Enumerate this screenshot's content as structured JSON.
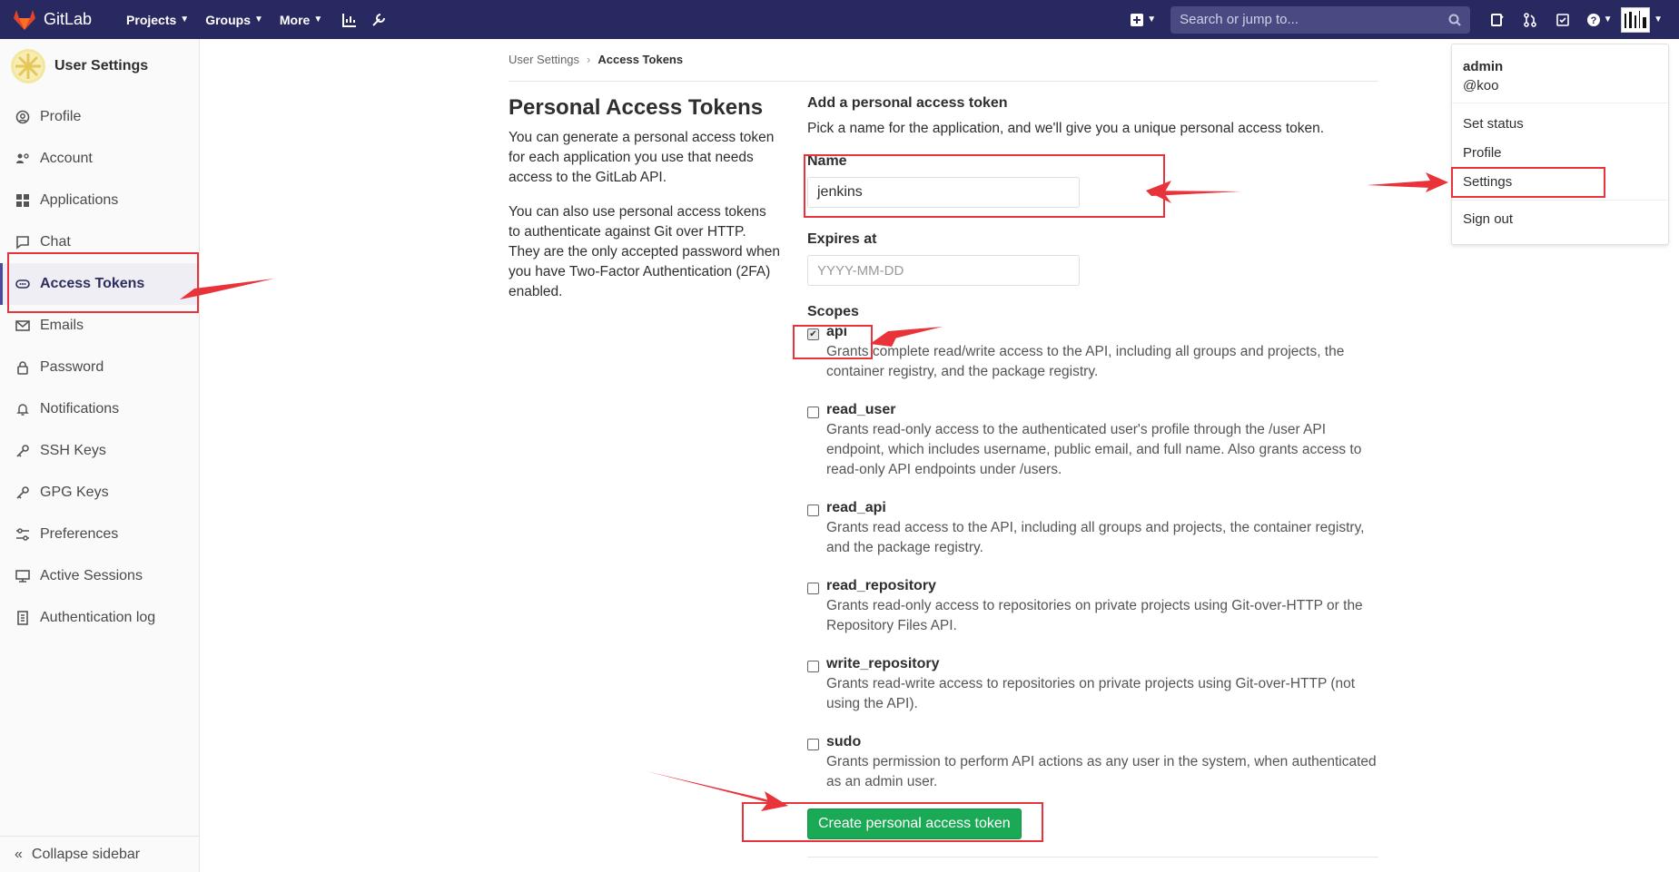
{
  "navbar": {
    "brand": "GitLab",
    "links": [
      {
        "label": "Projects"
      },
      {
        "label": "Groups"
      },
      {
        "label": "More"
      }
    ],
    "search_placeholder": "Search or jump to..."
  },
  "sidebar": {
    "title": "User Settings",
    "items": [
      {
        "label": "Profile",
        "icon": "profile-icon"
      },
      {
        "label": "Account",
        "icon": "account-icon"
      },
      {
        "label": "Applications",
        "icon": "applications-icon"
      },
      {
        "label": "Chat",
        "icon": "chat-icon"
      },
      {
        "label": "Access Tokens",
        "icon": "token-icon",
        "active": true
      },
      {
        "label": "Emails",
        "icon": "email-icon"
      },
      {
        "label": "Password",
        "icon": "lock-icon"
      },
      {
        "label": "Notifications",
        "icon": "bell-icon"
      },
      {
        "label": "SSH Keys",
        "icon": "key-icon"
      },
      {
        "label": "GPG Keys",
        "icon": "key-icon"
      },
      {
        "label": "Preferences",
        "icon": "preferences-icon"
      },
      {
        "label": "Active Sessions",
        "icon": "monitor-icon"
      },
      {
        "label": "Authentication log",
        "icon": "log-icon"
      }
    ],
    "collapse": "Collapse sidebar"
  },
  "breadcrumb": {
    "parent": "User Settings",
    "current": "Access Tokens"
  },
  "intro": {
    "title": "Personal Access Tokens",
    "p1": "You can generate a personal access token for each application you use that needs access to the GitLab API.",
    "p2": "You can also use personal access tokens to authenticate against Git over HTTP. They are the only accepted password when you have Two-Factor Authentication (2FA) enabled."
  },
  "form": {
    "heading": "Add a personal access token",
    "lead": "Pick a name for the application, and we'll give you a unique personal access token.",
    "name_label": "Name",
    "name_value": "jenkins",
    "expires_label": "Expires at",
    "expires_placeholder": "YYYY-MM-DD",
    "scopes_label": "Scopes",
    "scopes": [
      {
        "name": "api",
        "checked": true,
        "desc": "Grants complete read/write access to the API, including all groups and projects, the container registry, and the package registry."
      },
      {
        "name": "read_user",
        "checked": false,
        "desc": "Grants read-only access to the authenticated user's profile through the /user API endpoint, which includes username, public email, and full name. Also grants access to read-only API endpoints under /users."
      },
      {
        "name": "read_api",
        "checked": false,
        "desc": "Grants read access to the API, including all groups and projects, the container registry, and the package registry."
      },
      {
        "name": "read_repository",
        "checked": false,
        "desc": "Grants read-only access to repositories on private projects using Git-over-HTTP or the Repository Files API."
      },
      {
        "name": "write_repository",
        "checked": false,
        "desc": "Grants read-write access to repositories on private projects using Git-over-HTTP (not using the API)."
      },
      {
        "name": "sudo",
        "checked": false,
        "desc": "Grants permission to perform API actions as any user in the system, when authenticated as an admin user."
      }
    ],
    "submit": "Create personal access token"
  },
  "user_menu": {
    "name": "admin",
    "handle": "@koo",
    "items": [
      "Set status",
      "Profile",
      "Settings"
    ],
    "signout": "Sign out"
  },
  "colors": {
    "navbar": "#292961",
    "primary_button": "#1aaa55",
    "annotation": "#e8333a"
  }
}
